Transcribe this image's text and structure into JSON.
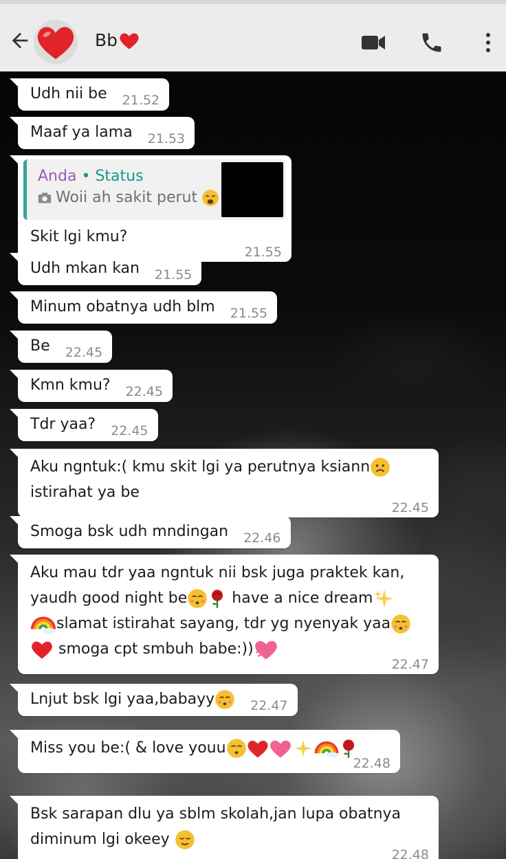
{
  "header": {
    "contact_name": "Bb",
    "colors": {
      "bar": "#ececec",
      "heart": "#e0242a"
    },
    "icons": [
      "back-arrow-icon",
      "video-call-icon",
      "phone-icon",
      "more-options-icon"
    ]
  },
  "messages": [
    {
      "text": "Udh nii be",
      "time": "21.52"
    },
    {
      "text": "Maaf ya lama",
      "time": "21.53"
    },
    {
      "quote_author": "Anda",
      "quote_sep": "•",
      "quote_label": "Status",
      "quote_text": "Woii ah sakit perut",
      "text": "Skit lgi kmu?",
      "time": "21.55"
    },
    {
      "text": "Udh mkan kan",
      "time": "21.55"
    },
    {
      "text": "Minum obatnya udh blm",
      "time": "21.55"
    },
    {
      "text": "Be",
      "time": "22.45"
    },
    {
      "text": "Kmn kmu?",
      "time": "22.45"
    },
    {
      "text": "Tdr yaa?",
      "time": "22.45"
    },
    {
      "line1": "Aku ngntuk:( kmu skit lgi ya perutnya ksiann",
      "line2": "istirahat ya be",
      "time": "22.45"
    },
    {
      "text": "Smoga bsk udh mndingan",
      "time": "22.46"
    },
    {
      "line1": "Aku mau tdr yaa ngntuk nii bsk juga praktek kan,",
      "line2a": "yaudh good night be",
      "line2b": " have a nice dream",
      "line3": "slamat istirahat sayang, tdr yg nyenyak yaa",
      "line4": " smoga cpt smbuh babe:))",
      "time": "22.47"
    },
    {
      "text": "Lnjut bsk lgi yaa,babayy",
      "time": "22.47"
    },
    {
      "text": "Miss you be:( & love youu",
      "time": "22.48"
    },
    {
      "line1": "Bsk sarapan dlu ya sblm skolah,jan lupa obatnya",
      "line2": "diminum lgi okeey",
      "time": "22.48"
    }
  ]
}
